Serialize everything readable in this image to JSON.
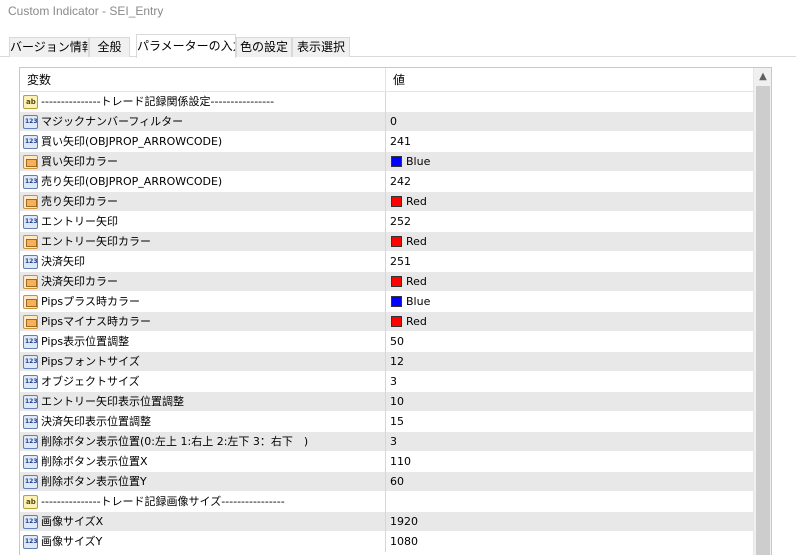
{
  "window": {
    "title": "Custom Indicator - SEI_Entry"
  },
  "tabs": [
    {
      "label": "バージョン情報"
    },
    {
      "label": "全般"
    },
    {
      "label": "パラメーターの入力",
      "active": true
    },
    {
      "label": "色の設定"
    },
    {
      "label": "表示選択"
    }
  ],
  "table": {
    "headers": {
      "name": "変数",
      "value": "値"
    },
    "rows": [
      {
        "icon": "string-icon",
        "name": "---------------トレード記録関係設定----------------",
        "value": ""
      },
      {
        "icon": "integer-icon",
        "name": "マジックナンバーフィルター",
        "value": "0"
      },
      {
        "icon": "integer-icon",
        "name": "買い矢印(OBJPROP_ARROWCODE)",
        "value": "241"
      },
      {
        "icon": "color-icon",
        "name": "買い矢印カラー",
        "value": "Blue",
        "color": "#0000ff"
      },
      {
        "icon": "integer-icon",
        "name": "売り矢印(OBJPROP_ARROWCODE)",
        "value": "242"
      },
      {
        "icon": "color-icon",
        "name": "売り矢印カラー",
        "value": "Red",
        "color": "#ff0000"
      },
      {
        "icon": "integer-icon",
        "name": "エントリー矢印",
        "value": "252"
      },
      {
        "icon": "color-icon",
        "name": "エントリー矢印カラー",
        "value": "Red",
        "color": "#ff0000"
      },
      {
        "icon": "integer-icon",
        "name": "決済矢印",
        "value": "251"
      },
      {
        "icon": "color-icon",
        "name": "決済矢印カラー",
        "value": "Red",
        "color": "#ff0000"
      },
      {
        "icon": "color-icon",
        "name": "Pipsプラス時カラー",
        "value": "Blue",
        "color": "#0000ff"
      },
      {
        "icon": "color-icon",
        "name": "Pipsマイナス時カラー",
        "value": "Red",
        "color": "#ff0000"
      },
      {
        "icon": "integer-icon",
        "name": "Pips表示位置調整",
        "value": "50"
      },
      {
        "icon": "integer-icon",
        "name": "Pipsフォントサイズ",
        "value": "12"
      },
      {
        "icon": "integer-icon",
        "name": "オブジェクトサイズ",
        "value": "3"
      },
      {
        "icon": "integer-icon",
        "name": "エントリー矢印表示位置調整",
        "value": "10"
      },
      {
        "icon": "integer-icon",
        "name": "決済矢印表示位置調整",
        "value": "15"
      },
      {
        "icon": "integer-icon",
        "name": "削除ボタン表示位置(0:左上 1:右上 2:左下 3：右下　)",
        "value": "3"
      },
      {
        "icon": "integer-icon",
        "name": "削除ボタン表示位置X",
        "value": "110"
      },
      {
        "icon": "integer-icon",
        "name": "削除ボタン表示位置Y",
        "value": "60"
      },
      {
        "icon": "string-icon",
        "name": "---------------トレード記録画像サイズ----------------",
        "value": ""
      },
      {
        "icon": "integer-icon",
        "name": "画像サイズX",
        "value": "1920"
      },
      {
        "icon": "integer-icon",
        "name": "画像サイズY",
        "value": "1080"
      }
    ]
  },
  "scrollbar": {
    "up_arrow": "▲"
  }
}
